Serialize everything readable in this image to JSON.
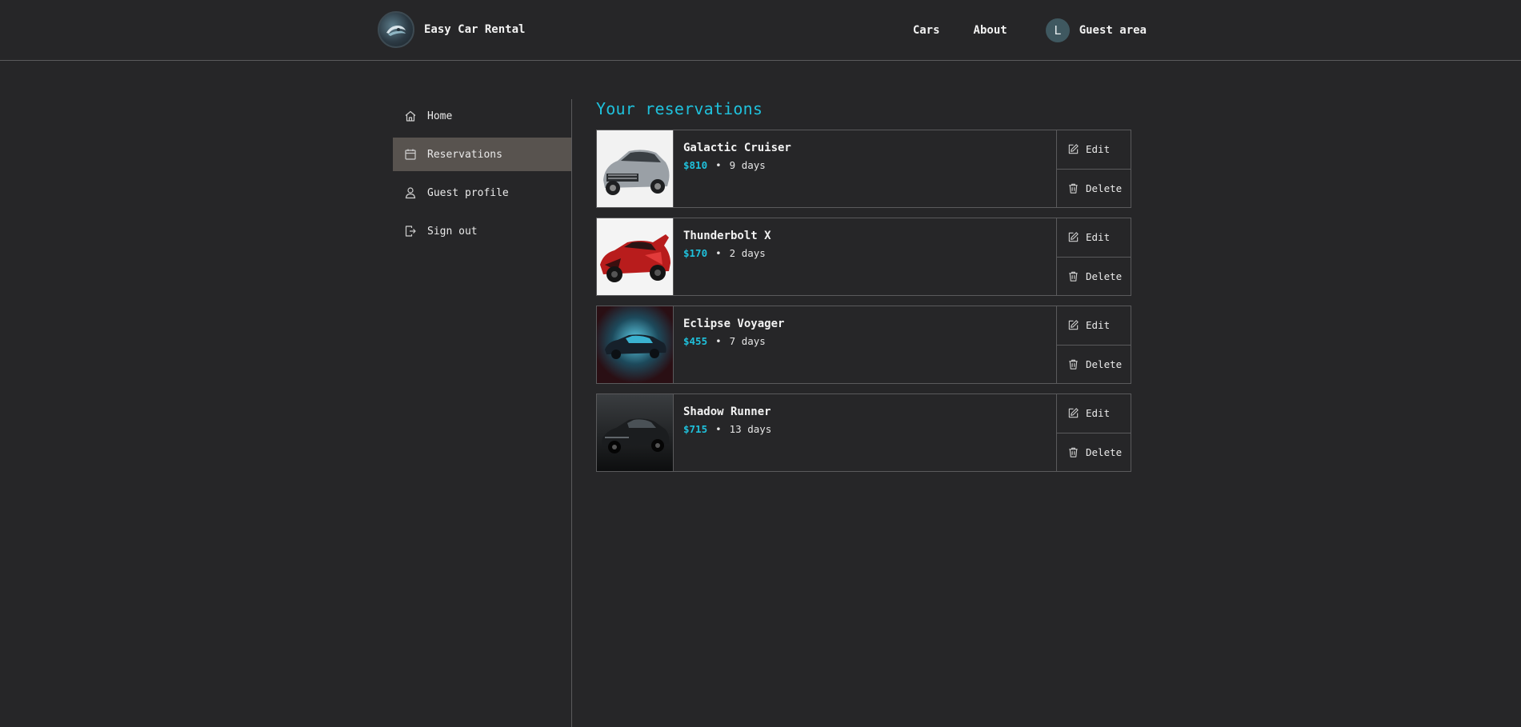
{
  "header": {
    "brand": "Easy Car Rental",
    "nav": [
      "Cars",
      "About"
    ],
    "guest_initial": "L",
    "guest_label": "Guest area"
  },
  "sidebar": {
    "items": [
      {
        "label": "Home",
        "icon": "home-icon"
      },
      {
        "label": "Reservations",
        "icon": "calendar-icon",
        "active": true
      },
      {
        "label": "Guest profile",
        "icon": "user-icon"
      },
      {
        "label": "Sign out",
        "icon": "sign-out-icon"
      }
    ]
  },
  "main": {
    "title": "Your reservations",
    "separator": "•",
    "edit_label": "Edit",
    "delete_label": "Delete",
    "reservations": [
      {
        "name": "Galactic Cruiser",
        "price": "$810",
        "duration": "9 days",
        "theme": "silver"
      },
      {
        "name": "Thunderbolt X",
        "price": "$170",
        "duration": "2 days",
        "theme": "red"
      },
      {
        "name": "Eclipse Voyager",
        "price": "$455",
        "duration": "7 days",
        "theme": "blue"
      },
      {
        "name": "Shadow Runner",
        "price": "$715",
        "duration": "13 days",
        "theme": "dark"
      }
    ]
  },
  "colors": {
    "accent": "#1fc1dc",
    "background": "#262628",
    "active_item": "#58534f",
    "border": "#5a5a5c"
  }
}
